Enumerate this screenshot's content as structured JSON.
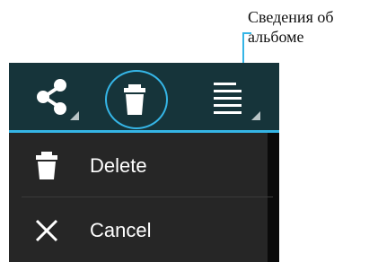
{
  "callout": {
    "line1": "Сведения об",
    "line2": "альбоме"
  },
  "toolbar": {
    "share_icon": "share-icon",
    "delete_icon": "trash-icon",
    "info_icon": "album-info-icon"
  },
  "menu": {
    "items": [
      {
        "label": "Delete",
        "icon": "trash-icon"
      },
      {
        "label": "Cancel",
        "icon": "close-icon"
      }
    ]
  },
  "colors": {
    "action_bar": "#16343a",
    "accent": "#35b5e6",
    "menu_bg": "#262626"
  }
}
